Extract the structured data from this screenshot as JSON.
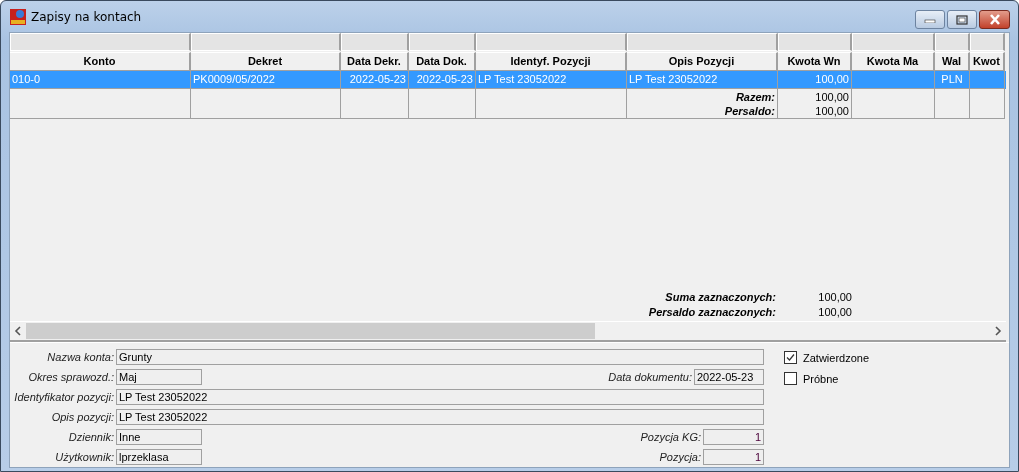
{
  "window": {
    "title": "Zapisy na kontach"
  },
  "table": {
    "columns": [
      "Konto",
      "Dekret",
      "Data Dekr.",
      "Data Dok.",
      "Identyf. Pozycji",
      "Opis  Pozycji",
      "Kwota Wn",
      "Kwota Ma",
      "Wal",
      "Kwot"
    ],
    "rows": [
      {
        "selected": true,
        "cells": [
          "010-0",
          "PK0009/05/2022",
          "2022-05-23",
          "2022-05-23",
          "LP Test 23052022",
          "LP Test 23052022",
          "100,00",
          "",
          "PLN",
          ""
        ]
      }
    ],
    "summary": [
      {
        "label": "Razem:",
        "value": "100,00"
      },
      {
        "label": "Persaldo:",
        "value": "100,00"
      }
    ]
  },
  "totals": [
    {
      "label": "Suma zaznaczonych:",
      "value": "100,00"
    },
    {
      "label": "Persaldo zaznaczonych:",
      "value": "100,00"
    }
  ],
  "form": {
    "rows": [
      {
        "label": "Nazwa konta:",
        "value": "Grunty",
        "kind": "wide"
      },
      {
        "label": "Okres sprawozd.:",
        "value": "Maj",
        "kind": "short",
        "extra": {
          "label": "Data dokumentu:",
          "value": "2022-05-23",
          "kind": "date"
        }
      },
      {
        "label": "Identyfikator pozycji:",
        "value": "LP Test 23052022",
        "kind": "wide"
      },
      {
        "label": "Opis pozycji:",
        "value": "LP Test 23052022",
        "kind": "wide"
      },
      {
        "label": "Dziennik:",
        "value": "Inne",
        "kind": "short",
        "extra": {
          "label": "Pozycja KG:",
          "value": "1",
          "kind": "number"
        }
      },
      {
        "label": "Użytkownik:",
        "value": "lprzeklasa",
        "kind": "short",
        "extra": {
          "label": "Pozycja:",
          "value": "1",
          "kind": "number"
        }
      }
    ],
    "checkboxes": [
      {
        "label": "Zatwierdzone",
        "checked": true
      },
      {
        "label": "Próbne",
        "checked": false
      }
    ]
  }
}
